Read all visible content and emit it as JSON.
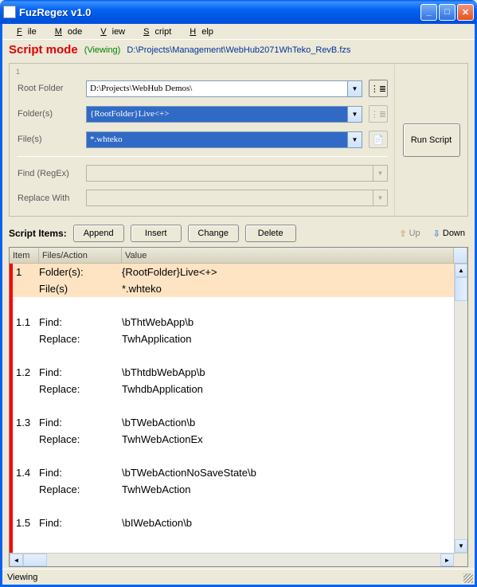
{
  "window": {
    "title": "FuzRegex v1.0"
  },
  "menu": {
    "file": "File",
    "mode": "Mode",
    "view": "View",
    "script": "Script",
    "help": "Help"
  },
  "mode": {
    "title": "Script mode",
    "view": "(Viewing)",
    "path": "D:\\Projects\\Management\\WebHub2071WhTeko_RevB.fzs"
  },
  "form": {
    "group_num": "1",
    "root_label": "Root Folder",
    "root_value": "D:\\Projects\\WebHub Demos\\",
    "folders_label": "Folder(s)",
    "folders_value": "{RootFolder}Live<+>",
    "files_label": "File(s)",
    "files_value": "*.whteko",
    "find_label": "Find (RegEx)",
    "find_value": "",
    "replace_label": "Replace With",
    "replace_value": ""
  },
  "run_btn": "Run Script",
  "items": {
    "label": "Script Items:",
    "append": "Append",
    "insert": "Insert",
    "change": "Change",
    "delete": "Delete",
    "up": "Up",
    "down": "Down"
  },
  "grid": {
    "h_item": "Item",
    "h_fa": "Files/Action",
    "h_val": "Value",
    "rows": [
      {
        "c1": "1",
        "c2": "Folder(s):",
        "c3": "{RootFolder}Live<+>",
        "peach": true
      },
      {
        "c1": "",
        "c2": "File(s)",
        "c3": "*.whteko",
        "peach": true
      },
      {
        "c1": "",
        "c2": "",
        "c3": ""
      },
      {
        "c1": "1.1",
        "c2": "Find:",
        "c3": "\\bThtWebApp\\b"
      },
      {
        "c1": "",
        "c2": "Replace:",
        "c3": "TwhApplication"
      },
      {
        "c1": "",
        "c2": "",
        "c3": ""
      },
      {
        "c1": "1.2",
        "c2": "Find:",
        "c3": "\\bThtdbWebApp\\b"
      },
      {
        "c1": "",
        "c2": "Replace:",
        "c3": "TwhdbApplication"
      },
      {
        "c1": "",
        "c2": "",
        "c3": ""
      },
      {
        "c1": "1.3",
        "c2": "Find:",
        "c3": "\\bTWebAction\\b"
      },
      {
        "c1": "",
        "c2": "Replace:",
        "c3": "TwhWebActionEx"
      },
      {
        "c1": "",
        "c2": "",
        "c3": ""
      },
      {
        "c1": "1.4",
        "c2": "Find:",
        "c3": "\\bTWebActionNoSaveState\\b"
      },
      {
        "c1": "",
        "c2": "Replace:",
        "c3": "TwhWebAction"
      },
      {
        "c1": "",
        "c2": "",
        "c3": ""
      },
      {
        "c1": "1.5",
        "c2": "Find:",
        "c3": "\\bIWebAction\\b"
      }
    ]
  },
  "status": {
    "text": "Viewing"
  }
}
